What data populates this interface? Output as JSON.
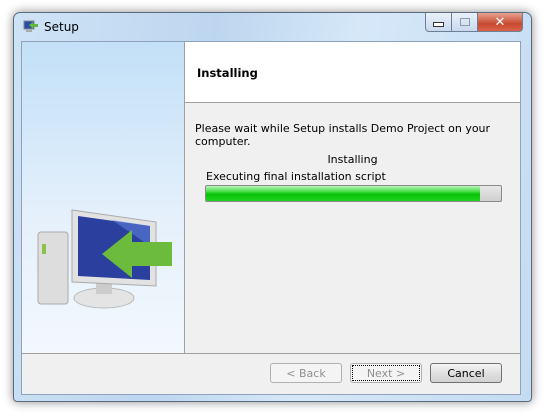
{
  "window": {
    "title": "Setup",
    "icon": "computer-setup-icon",
    "controls": [
      "minimize",
      "maximize",
      "close"
    ]
  },
  "header": {
    "title": "Installing"
  },
  "main": {
    "description": "Please wait while Setup installs Demo Project on your computer.",
    "status": "Installing",
    "action": "Executing final installation script"
  },
  "progress": {
    "percent": 93,
    "color": "#06c406"
  },
  "buttons": {
    "back": "< Back",
    "next": "Next >",
    "cancel": "Cancel"
  },
  "illustration": "computer-with-green-arrow"
}
